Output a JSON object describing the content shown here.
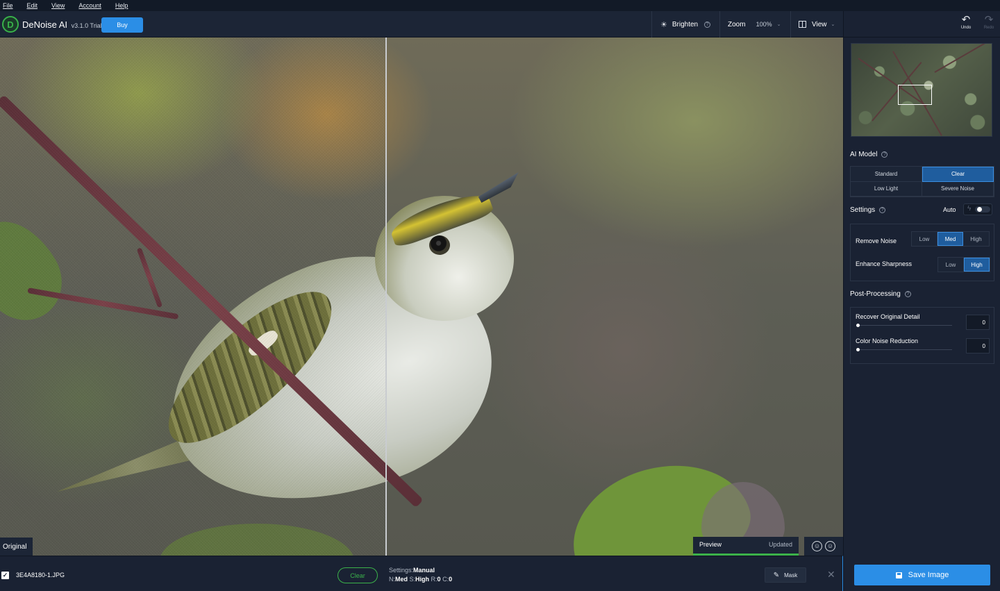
{
  "menu": [
    "File",
    "Edit",
    "View",
    "Account",
    "Help"
  ],
  "app": {
    "name": "DeNoise AI",
    "version": "v3.1.0 Trial",
    "logo_letter": "D",
    "buy_label": "Buy"
  },
  "toolbar": {
    "brighten_label": "Brighten",
    "zoom_label": "Zoom",
    "zoom_value": "100%",
    "view_label": "View",
    "help_glyph": "?"
  },
  "history": {
    "undo_label": "Undo",
    "redo_label": "Redo"
  },
  "panel": {
    "ai_model_title": "AI Model",
    "models": [
      {
        "label": "Standard",
        "active": false
      },
      {
        "label": "Clear",
        "active": true
      },
      {
        "label": "Low Light",
        "active": false
      },
      {
        "label": "Severe Noise",
        "active": false
      }
    ],
    "settings_title": "Settings",
    "auto_label": "Auto",
    "remove_noise": {
      "label": "Remove Noise",
      "options": [
        "Low",
        "Med",
        "High"
      ],
      "selected": "Med"
    },
    "enhance_sharpness": {
      "label": "Enhance Sharpness",
      "options": [
        "Low",
        "High"
      ],
      "selected": "High"
    },
    "post_processing_title": "Post-Processing",
    "recover_detail": {
      "label": "Recover Original Detail",
      "value": "0"
    },
    "color_noise": {
      "label": "Color Noise Reduction",
      "value": "0"
    },
    "save_label": "Save Image"
  },
  "viewer": {
    "original_label": "Original",
    "preview_label": "Preview",
    "preview_status": "Updated",
    "preview_progress": 1.0
  },
  "bottom": {
    "filename": "3E4A8180-1.JPG",
    "clear_label": "Clear",
    "settings_prefix": "Settings:",
    "settings_mode": "Manual",
    "n_prefix": "N:",
    "n_value": "Med",
    "s_prefix": "S:",
    "s_value": "High",
    "r_prefix": "R:",
    "r_value": "0",
    "c_prefix": "C:",
    "c_value": "0",
    "mask_label": "Mask"
  },
  "colors": {
    "accent": "#2b8ee6",
    "green": "#3bb24a",
    "panel": "#1a2233"
  }
}
